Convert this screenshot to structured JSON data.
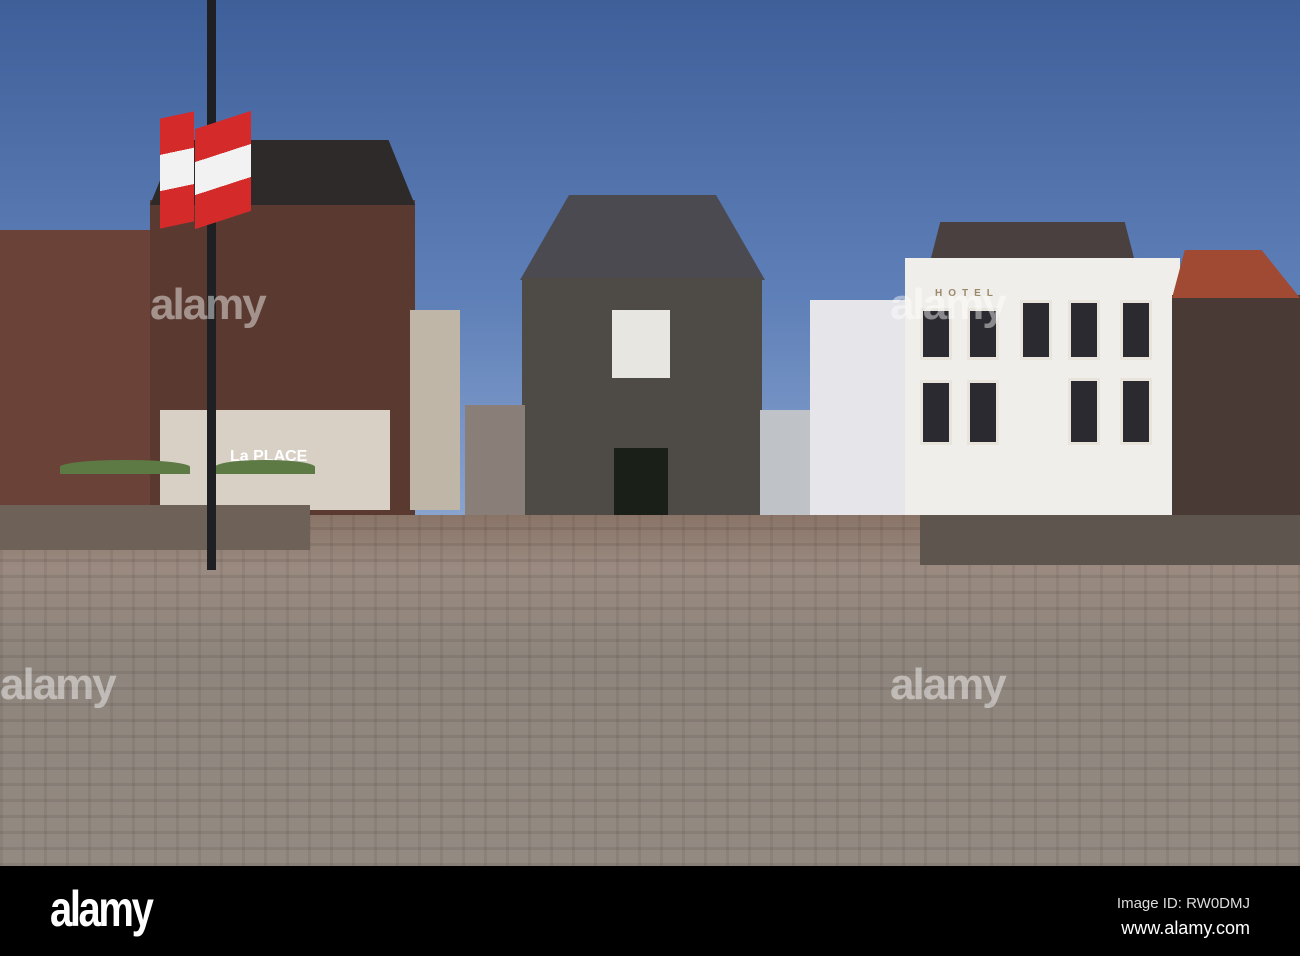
{
  "photo": {
    "signs": {
      "cafe": "La PLACE",
      "hotel": "HOTEL"
    },
    "watermark": "alamy"
  },
  "footer": {
    "logo": "alamy",
    "image_id": "Image ID: RW0DMJ",
    "url": "www.alamy.com"
  }
}
